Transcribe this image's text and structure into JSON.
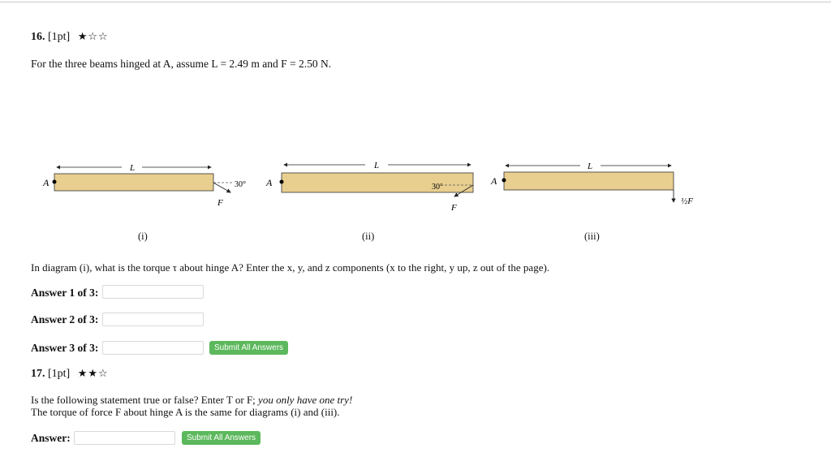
{
  "q16": {
    "number": "16.",
    "points": "[1pt]",
    "stars": "★☆☆",
    "prompt": "For the three beams hinged at A, assume L = 2.49 m and F = 2.50 N.",
    "diagram": {
      "length_label": "L",
      "hinge_label": "A",
      "force_label": "F⃗",
      "half_force_label": "½F⃗",
      "angle_label": "30°",
      "captions": [
        "(i)",
        "(ii)",
        "(iii)"
      ]
    },
    "question": "In diagram (i), what is the torque τ about hinge A? Enter the x, y, and z components (x to the right, y up, z out of the page).",
    "answers": [
      {
        "label": "Answer 1 of 3:",
        "value": ""
      },
      {
        "label": "Answer 2 of 3:",
        "value": ""
      },
      {
        "label": "Answer 3 of 3:",
        "value": ""
      }
    ],
    "submit_label": "Submit All Answers"
  },
  "q17": {
    "number": "17.",
    "points": "[1pt]",
    "stars": "★★☆",
    "prompt_main": "Is the following statement true or false? Enter T or F;",
    "prompt_emph": "you only have one try!",
    "statement": "The torque of force F about hinge A is the same for diagrams (i) and (iii).",
    "answer_label": "Answer:",
    "answer_value": "",
    "submit_label": "Submit All Answers"
  }
}
